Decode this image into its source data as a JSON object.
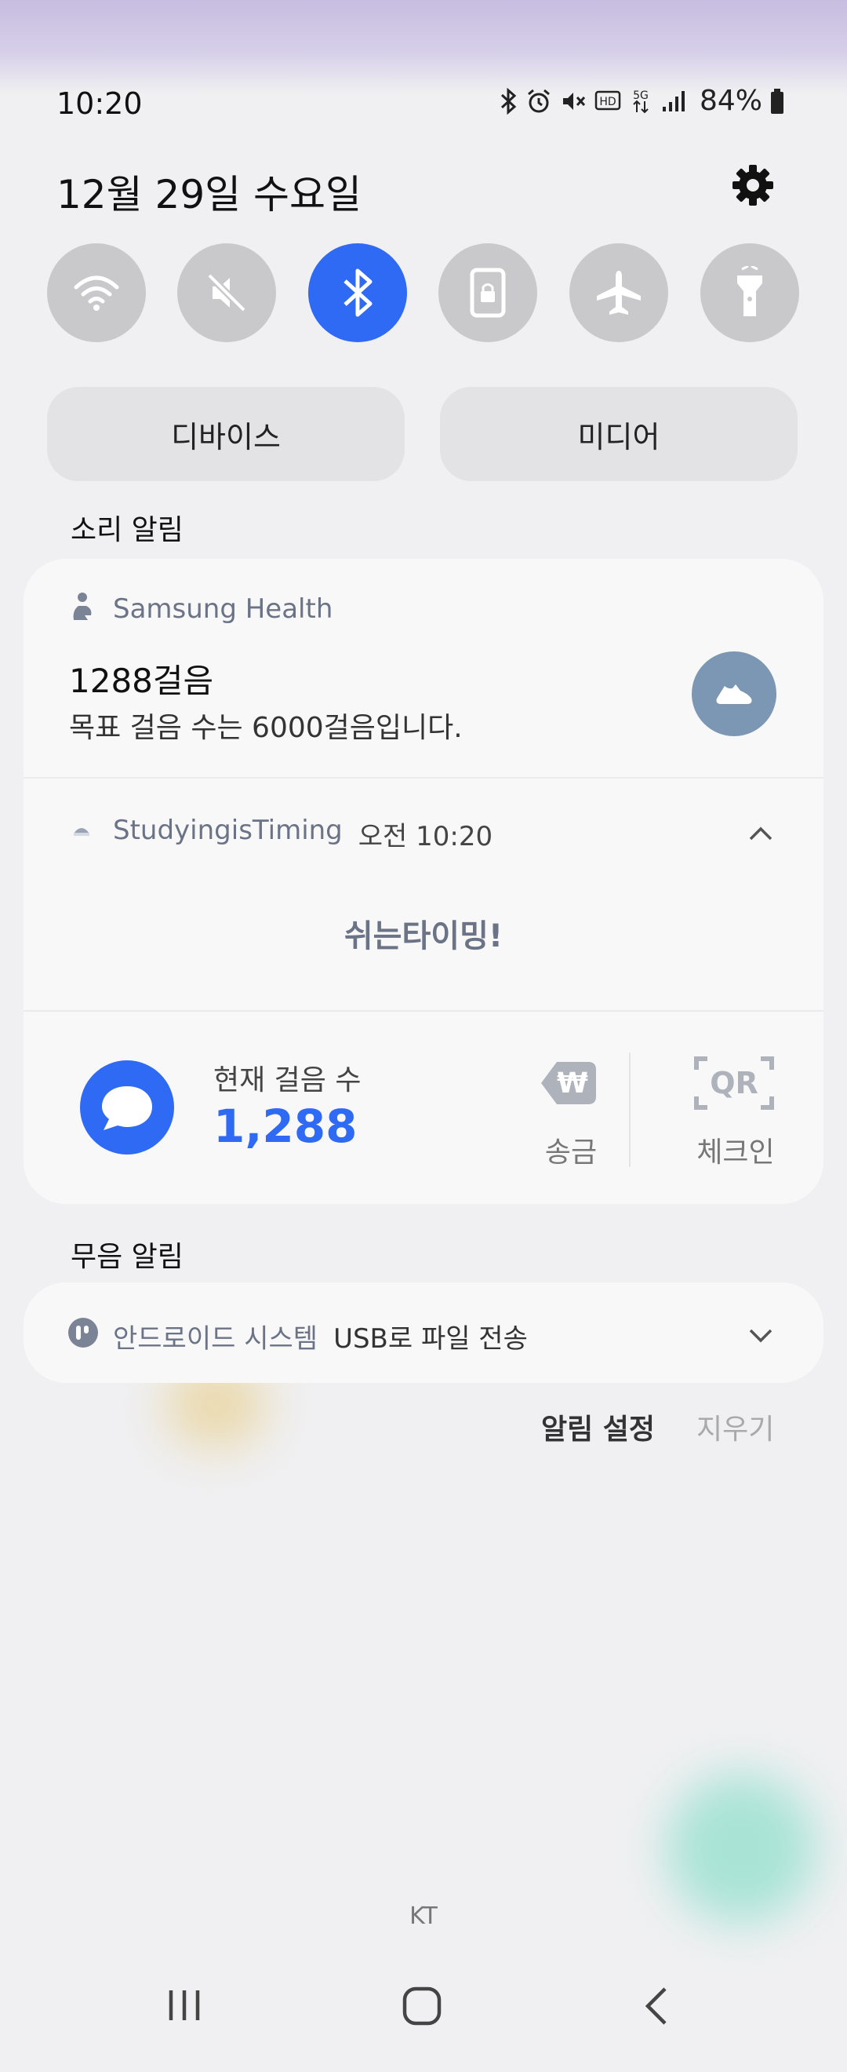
{
  "status_bar": {
    "time": "10:20",
    "battery": "84%",
    "icons": [
      "bluetooth-icon",
      "alarm-icon",
      "mute-icon",
      "hd-voice-icon",
      "5g-icon",
      "signal-icon",
      "battery-icon"
    ]
  },
  "header": {
    "date": "12월 29일 수요일"
  },
  "quick_settings": [
    {
      "name": "wifi-icon",
      "active": false
    },
    {
      "name": "sound-mute-icon",
      "active": false
    },
    {
      "name": "bluetooth-icon",
      "active": true
    },
    {
      "name": "lock-rotation-icon",
      "active": false
    },
    {
      "name": "airplane-icon",
      "active": false
    },
    {
      "name": "flashlight-icon",
      "active": false
    }
  ],
  "pills": {
    "devices": "디바이스",
    "media": "미디어"
  },
  "sections": {
    "sound_alerts": "소리 알림",
    "silent_alerts": "무음 알림"
  },
  "health": {
    "app": "Samsung Health",
    "steps_title": "1288걸음",
    "goal_text": "목표 걸음 수는 6000걸음입니다."
  },
  "studying": {
    "app": "StudyingisTiming",
    "time": "오전 10:20",
    "message": "쉬는타이밍!"
  },
  "steps_widget": {
    "label": "현재 걸음 수",
    "value": "1,288",
    "send_label": "송금",
    "checkin_label": "체크인",
    "qr_text": "QR",
    "won_symbol": "₩"
  },
  "android": {
    "app": "안드로이드 시스템",
    "title": "USB로 파일 전송"
  },
  "actions": {
    "settings": "알림 설정",
    "clear": "지우기"
  },
  "carrier": "KT",
  "colors": {
    "accent": "#2f6af5",
    "toggle_inactive": "#c9c9cb",
    "value_blue": "#2f6af5",
    "shoe_bg": "#7b97b3"
  }
}
